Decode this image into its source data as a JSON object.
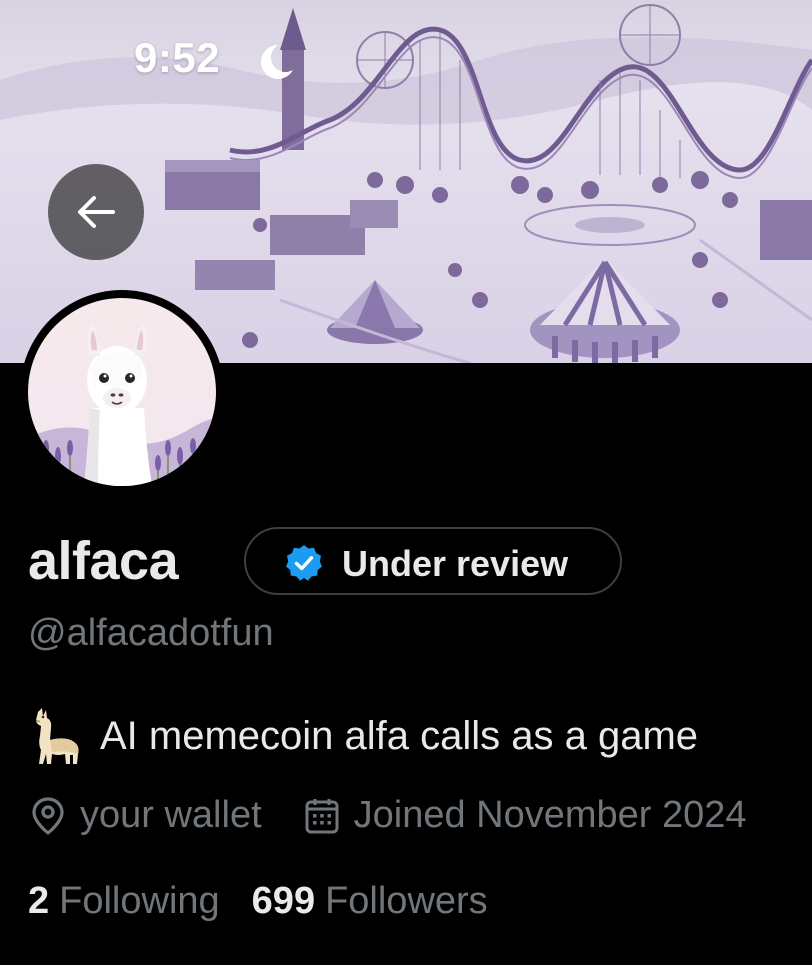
{
  "status_bar": {
    "time": "9:52",
    "moon_icon": "crescent-moon-icon"
  },
  "banner": {
    "description_palette": [
      "#e9e4f1",
      "#c9bedd",
      "#8f7bb1",
      "#5d4a82"
    ]
  },
  "nav": {
    "back_icon": "arrow-left-icon"
  },
  "profile": {
    "display_name": "alfaca",
    "verification": {
      "icon": "verified-badge-icon",
      "label": "Under review",
      "color": "#1d9bf0"
    },
    "handle": "@alfacadotfun",
    "bio": {
      "emoji_icon": "llama-emoji-icon",
      "text": "AI memecoin alfa calls as a game"
    },
    "location": "your wallet",
    "joined": "Joined November 2024",
    "following": {
      "count": "2",
      "label": "Following"
    },
    "followers": {
      "count": "699",
      "label": "Followers"
    }
  },
  "colors": {
    "background": "#000000",
    "primary_text": "#e7e9ea",
    "secondary_text": "#71767b",
    "badge_border": "#3b3f43",
    "verified_blue": "#1d9bf0"
  }
}
